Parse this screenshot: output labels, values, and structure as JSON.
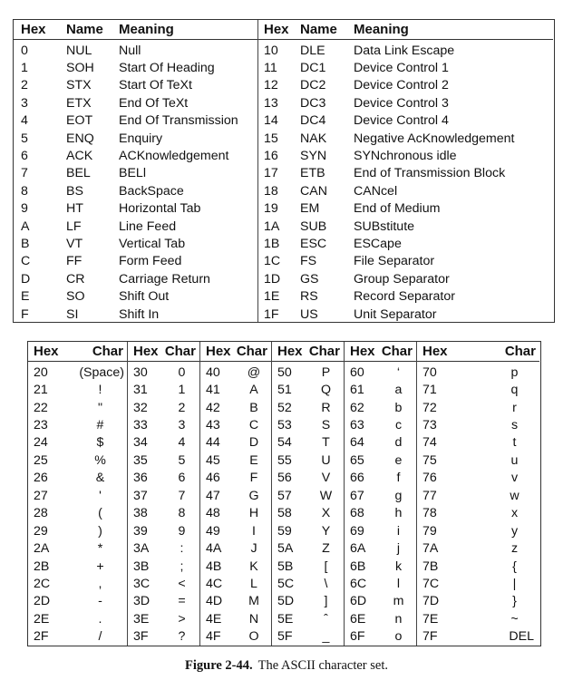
{
  "control_table": {
    "headers": {
      "hex": "Hex",
      "name": "Name",
      "meaning": "Meaning"
    },
    "left": [
      {
        "hex": "0",
        "name": "NUL",
        "meaning": "Null"
      },
      {
        "hex": "1",
        "name": "SOH",
        "meaning": "Start Of Heading"
      },
      {
        "hex": "2",
        "name": "STX",
        "meaning": "Start Of TeXt"
      },
      {
        "hex": "3",
        "name": "ETX",
        "meaning": "End Of TeXt"
      },
      {
        "hex": "4",
        "name": "EOT",
        "meaning": "End Of Transmission"
      },
      {
        "hex": "5",
        "name": "ENQ",
        "meaning": "Enquiry"
      },
      {
        "hex": "6",
        "name": "ACK",
        "meaning": "ACKnowledgement"
      },
      {
        "hex": "7",
        "name": "BEL",
        "meaning": "BELl"
      },
      {
        "hex": "8",
        "name": "BS",
        "meaning": "BackSpace"
      },
      {
        "hex": "9",
        "name": "HT",
        "meaning": "Horizontal Tab"
      },
      {
        "hex": "A",
        "name": "LF",
        "meaning": "Line Feed"
      },
      {
        "hex": "B",
        "name": "VT",
        "meaning": "Vertical Tab"
      },
      {
        "hex": "C",
        "name": "FF",
        "meaning": "Form Feed"
      },
      {
        "hex": "D",
        "name": "CR",
        "meaning": "Carriage Return"
      },
      {
        "hex": "E",
        "name": "SO",
        "meaning": "Shift Out"
      },
      {
        "hex": "F",
        "name": "SI",
        "meaning": "Shift In"
      }
    ],
    "right": [
      {
        "hex": "10",
        "name": "DLE",
        "meaning": "Data Link Escape"
      },
      {
        "hex": "11",
        "name": "DC1",
        "meaning": "Device Control 1"
      },
      {
        "hex": "12",
        "name": "DC2",
        "meaning": "Device Control 2"
      },
      {
        "hex": "13",
        "name": "DC3",
        "meaning": "Device Control 3"
      },
      {
        "hex": "14",
        "name": "DC4",
        "meaning": "Device Control 4"
      },
      {
        "hex": "15",
        "name": "NAK",
        "meaning": "Negative AcKnowledgement"
      },
      {
        "hex": "16",
        "name": "SYN",
        "meaning": "SYNchronous idle"
      },
      {
        "hex": "17",
        "name": "ETB",
        "meaning": "End of Transmission Block"
      },
      {
        "hex": "18",
        "name": "CAN",
        "meaning": "CANcel"
      },
      {
        "hex": "19",
        "name": "EM",
        "meaning": "End of Medium"
      },
      {
        "hex": "1A",
        "name": "SUB",
        "meaning": "SUBstitute"
      },
      {
        "hex": "1B",
        "name": "ESC",
        "meaning": "ESCape"
      },
      {
        "hex": "1C",
        "name": "FS",
        "meaning": "File Separator"
      },
      {
        "hex": "1D",
        "name": "GS",
        "meaning": "Group Separator"
      },
      {
        "hex": "1E",
        "name": "RS",
        "meaning": "Record Separator"
      },
      {
        "hex": "1F",
        "name": "US",
        "meaning": "Unit Separator"
      }
    ]
  },
  "char_table": {
    "headers": {
      "hex": "Hex",
      "char": "Char"
    },
    "groups": [
      [
        [
          "20",
          "(Space)"
        ],
        [
          "21",
          "!"
        ],
        [
          "22",
          "\""
        ],
        [
          "23",
          "#"
        ],
        [
          "24",
          "$"
        ],
        [
          "25",
          "%"
        ],
        [
          "26",
          "&"
        ],
        [
          "27",
          "'"
        ],
        [
          "28",
          "("
        ],
        [
          "29",
          ")"
        ],
        [
          "2A",
          "*"
        ],
        [
          "2B",
          "+"
        ],
        [
          "2C",
          ","
        ],
        [
          "2D",
          "-"
        ],
        [
          "2E",
          "."
        ],
        [
          "2F",
          "/"
        ]
      ],
      [
        [
          "30",
          "0"
        ],
        [
          "31",
          "1"
        ],
        [
          "32",
          "2"
        ],
        [
          "33",
          "3"
        ],
        [
          "34",
          "4"
        ],
        [
          "35",
          "5"
        ],
        [
          "36",
          "6"
        ],
        [
          "37",
          "7"
        ],
        [
          "38",
          "8"
        ],
        [
          "39",
          "9"
        ],
        [
          "3A",
          ":"
        ],
        [
          "3B",
          ";"
        ],
        [
          "3C",
          "<"
        ],
        [
          "3D",
          "="
        ],
        [
          "3E",
          ">"
        ],
        [
          "3F",
          "?"
        ]
      ],
      [
        [
          "40",
          "@"
        ],
        [
          "41",
          "A"
        ],
        [
          "42",
          "B"
        ],
        [
          "43",
          "C"
        ],
        [
          "44",
          "D"
        ],
        [
          "45",
          "E"
        ],
        [
          "46",
          "F"
        ],
        [
          "47",
          "G"
        ],
        [
          "48",
          "H"
        ],
        [
          "49",
          "I"
        ],
        [
          "4A",
          "J"
        ],
        [
          "4B",
          "K"
        ],
        [
          "4C",
          "L"
        ],
        [
          "4D",
          "M"
        ],
        [
          "4E",
          "N"
        ],
        [
          "4F",
          "O"
        ]
      ],
      [
        [
          "50",
          "P"
        ],
        [
          "51",
          "Q"
        ],
        [
          "52",
          "R"
        ],
        [
          "53",
          "S"
        ],
        [
          "54",
          "T"
        ],
        [
          "55",
          "U"
        ],
        [
          "56",
          "V"
        ],
        [
          "57",
          "W"
        ],
        [
          "58",
          "X"
        ],
        [
          "59",
          "Y"
        ],
        [
          "5A",
          "Z"
        ],
        [
          "5B",
          "["
        ],
        [
          "5C",
          "\\"
        ],
        [
          "5D",
          "]"
        ],
        [
          "5E",
          "ˆ"
        ],
        [
          "5F",
          "_"
        ]
      ],
      [
        [
          "60",
          "‘"
        ],
        [
          "61",
          "a"
        ],
        [
          "62",
          "b"
        ],
        [
          "63",
          "c"
        ],
        [
          "64",
          "d"
        ],
        [
          "65",
          "e"
        ],
        [
          "66",
          "f"
        ],
        [
          "67",
          "g"
        ],
        [
          "68",
          "h"
        ],
        [
          "69",
          "i"
        ],
        [
          "6A",
          "j"
        ],
        [
          "6B",
          "k"
        ],
        [
          "6C",
          "l"
        ],
        [
          "6D",
          "m"
        ],
        [
          "6E",
          "n"
        ],
        [
          "6F",
          "o"
        ]
      ],
      [
        [
          "70",
          "p"
        ],
        [
          "71",
          "q"
        ],
        [
          "72",
          "r"
        ],
        [
          "73",
          "s"
        ],
        [
          "74",
          "t"
        ],
        [
          "75",
          "u"
        ],
        [
          "76",
          "v"
        ],
        [
          "77",
          "w"
        ],
        [
          "78",
          "x"
        ],
        [
          "79",
          "y"
        ],
        [
          "7A",
          "z"
        ],
        [
          "7B",
          "{"
        ],
        [
          "7C",
          "|"
        ],
        [
          "7D",
          "}"
        ],
        [
          "7E",
          "~"
        ],
        [
          "7F",
          "DEL"
        ]
      ]
    ]
  },
  "caption": {
    "label": "Figure 2-44.",
    "text": "The ASCII character set."
  }
}
